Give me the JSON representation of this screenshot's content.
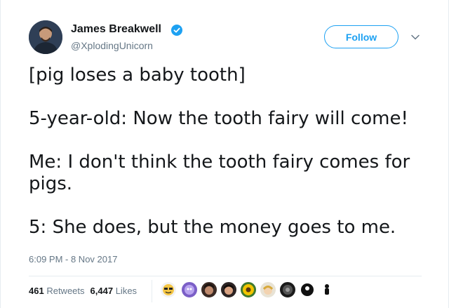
{
  "author": {
    "name": "James Breakwell",
    "handle": "@XplodingUnicorn",
    "verified": true
  },
  "follow_label": "Follow",
  "tweet_lines": [
    "[pig loses a baby tooth]",
    "",
    "5-year-old: Now the tooth fairy will come!",
    "",
    "Me: I don't think the tooth fairy comes for",
    "pigs.",
    "",
    "5: She does, but the money goes to me."
  ],
  "timestamp": "6:09 PM - 8 Nov 2017",
  "stats": {
    "retweets_count": "461",
    "retweets_label": "Retweets",
    "likes_count": "6,447",
    "likes_label": "Likes"
  },
  "colors": {
    "accent": "#1da1f2",
    "secondary_text": "#657786",
    "primary_text": "#14171a"
  },
  "liker_avatars": [
    {
      "icon": "avatar-emoji-face"
    },
    {
      "icon": "avatar-purple-cartoon"
    },
    {
      "icon": "avatar-dark-hair"
    },
    {
      "icon": "avatar-dark-hair"
    },
    {
      "icon": "avatar-sunflower"
    },
    {
      "icon": "avatar-cartoon-face"
    },
    {
      "icon": "avatar-dark-photo"
    },
    {
      "icon": "avatar-black-white"
    },
    {
      "icon": "avatar-black-figure"
    }
  ]
}
